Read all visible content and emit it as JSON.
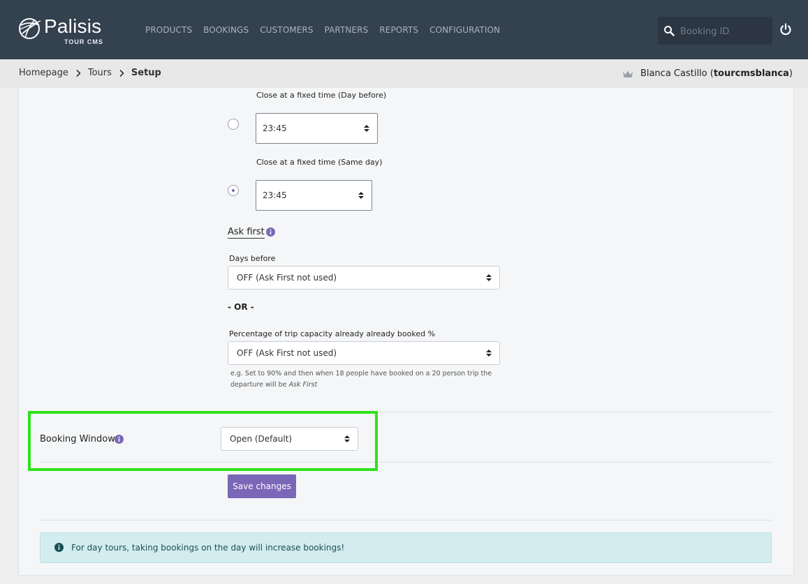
{
  "brand": {
    "name": "Palisis",
    "sub": "TOUR CMS"
  },
  "nav": {
    "items": [
      "PRODUCTS",
      "BOOKINGS",
      "CUSTOMERS",
      "PARTNERS",
      "REPORTS",
      "CONFIGURATION"
    ]
  },
  "search": {
    "placeholder": "Booking ID",
    "value": ""
  },
  "breadcrumb": {
    "items": [
      "Homepage",
      "Tours"
    ],
    "current": "Setup"
  },
  "user": {
    "name": "Blanca Castillo",
    "handle": "tourcmsblanca"
  },
  "close_day_before": {
    "label": "Close at a fixed time (Day before)",
    "value": "23:45",
    "checked": false
  },
  "close_same_day": {
    "label": "Close at a fixed time (Same day)",
    "value": "23:45",
    "checked": true
  },
  "ask_first": {
    "heading": "Ask first",
    "days_before_label": "Days before",
    "days_before_value": "OFF (Ask First not used)",
    "or_text": "- OR -",
    "percentage_label": "Percentage of trip capacity already already booked %",
    "percentage_value": "OFF (Ask First not used)",
    "help_text": "e.g. Set to 90% and then when 18 people have booked on a 20 person trip the departure will be",
    "help_emphasis": "Ask First"
  },
  "booking_window": {
    "label": "Booking Window",
    "value": "Open (Default)"
  },
  "save_label": "Save changes",
  "alert": {
    "text": "For day tours, taking bookings on the day will increase bookings!"
  },
  "colors": {
    "topbar": "#34414f",
    "accent": "#7b67b8",
    "highlight": "#2ee31b",
    "alert_bg": "#d2ecef"
  }
}
